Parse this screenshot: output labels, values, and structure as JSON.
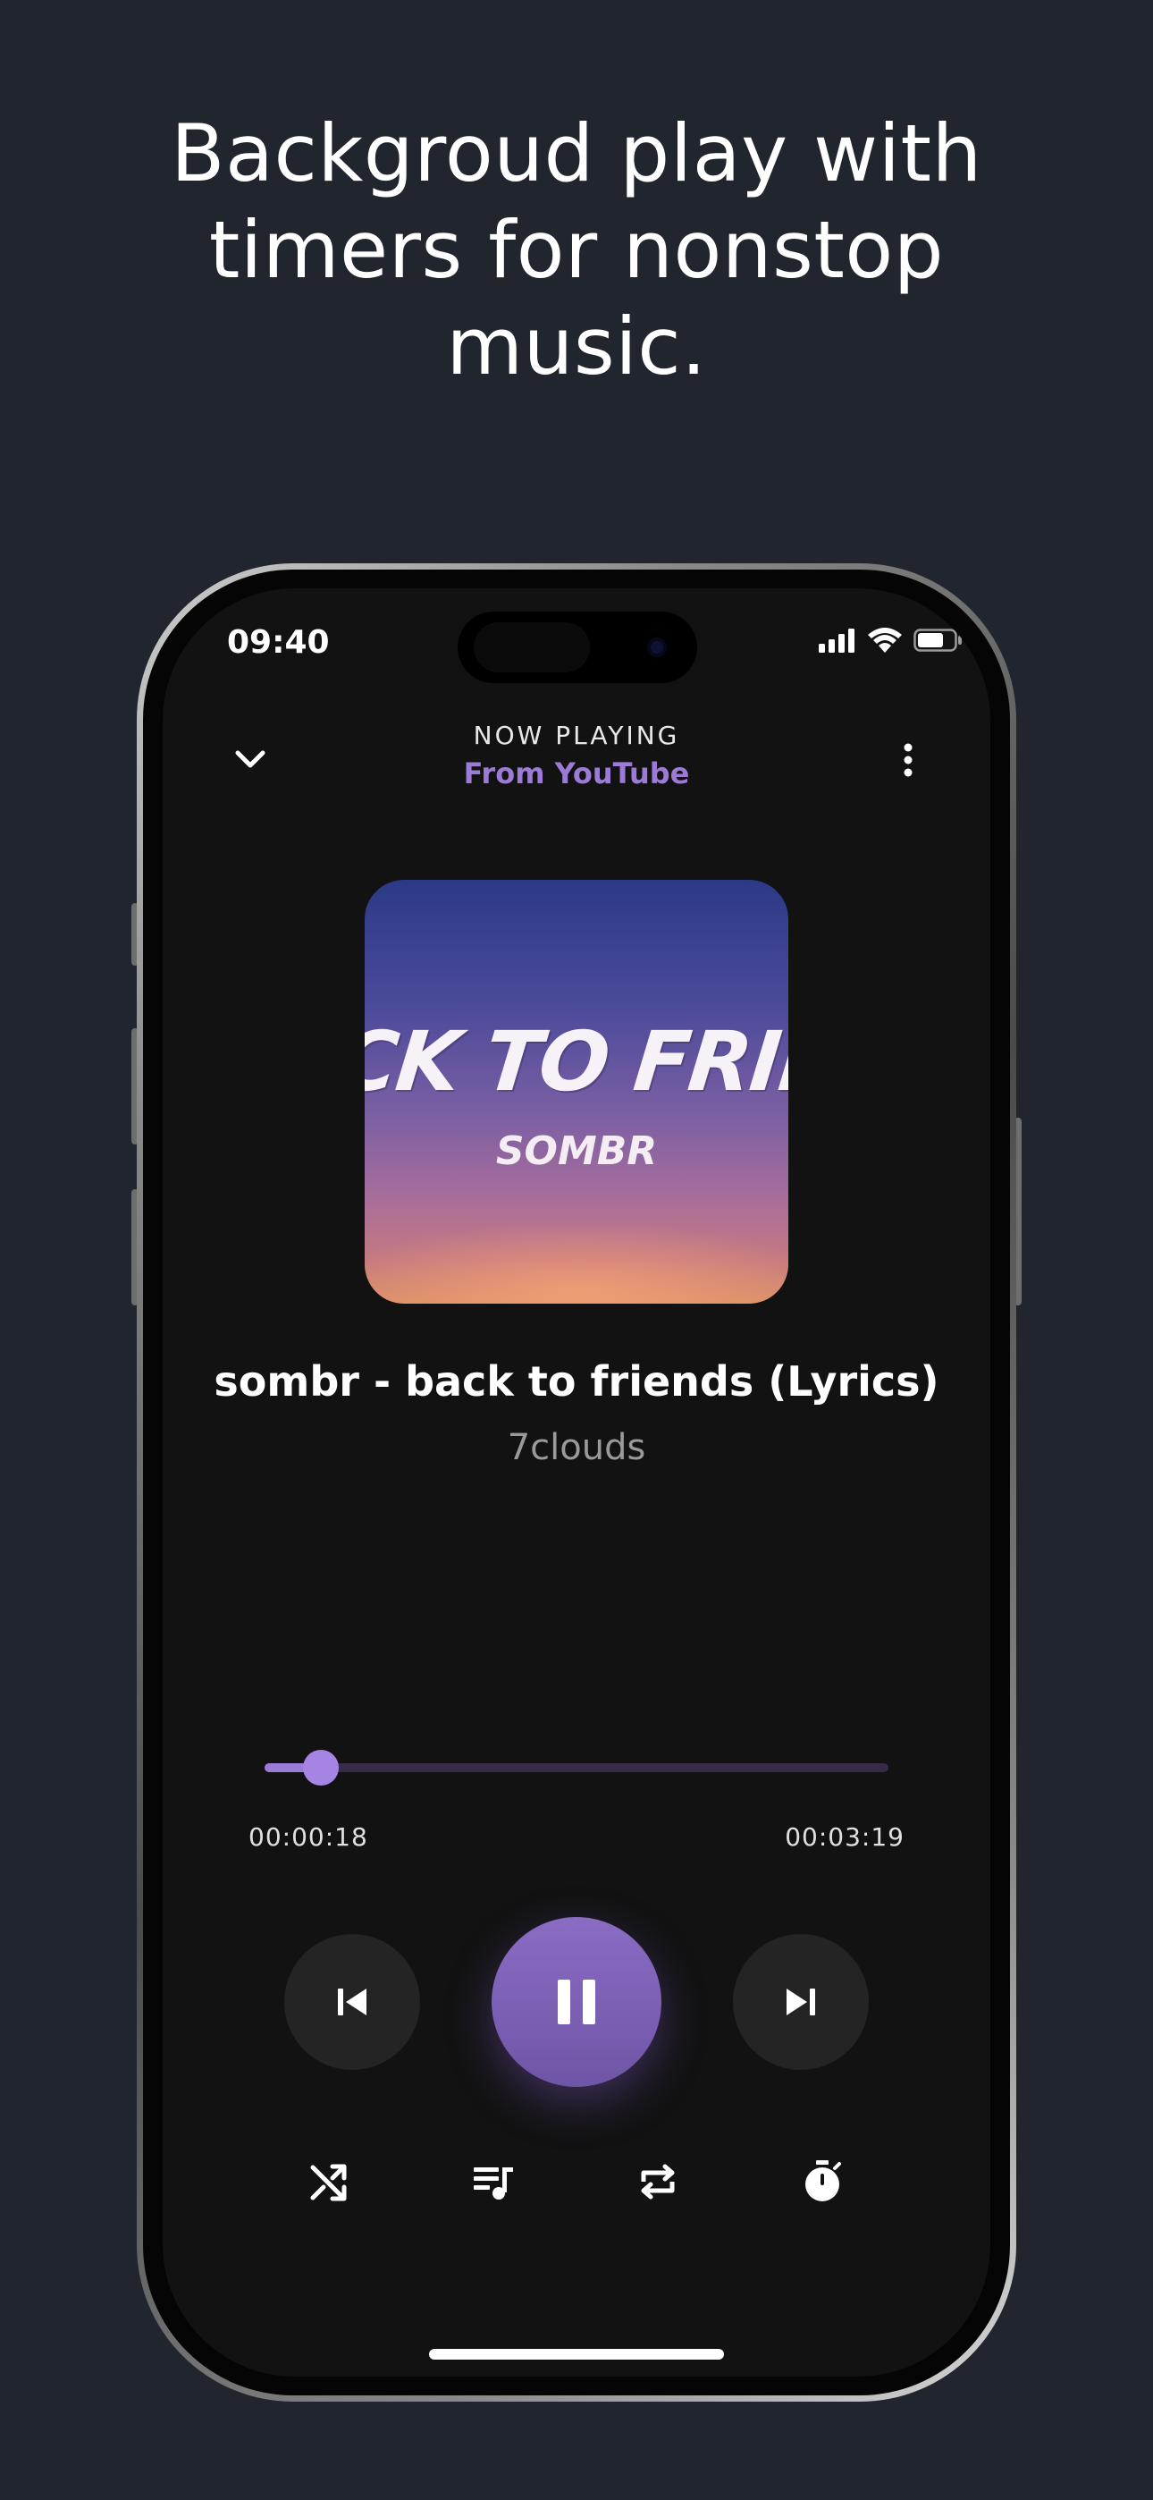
{
  "headline": {
    "line1": "Backgroud play with",
    "line2": "timers for nonstop",
    "line3": "music."
  },
  "status_bar": {
    "time": "09:40",
    "icons": [
      "cellular-signal-icon",
      "wifi-icon",
      "battery-icon"
    ]
  },
  "player_header": {
    "label": "NOW PLAYING",
    "source": "From YouTube",
    "icons": [
      "chevron-down-icon",
      "more-vertical-icon"
    ]
  },
  "album_art": {
    "title_text": "CK TO FRIEI",
    "artist_text": "SOMBR"
  },
  "track": {
    "title": "sombr - back to friends (Lyrics)",
    "artist": "7clouds"
  },
  "progress": {
    "current_time": "00:00:18",
    "total_time": "00:03:19",
    "fraction": 0.09
  },
  "controls": {
    "previous": "skip-previous-icon",
    "play_pause": "pause-icon",
    "next": "skip-next-icon"
  },
  "bottom_actions": [
    "shuffle-icon",
    "queue-music-icon",
    "repeat-icon",
    "sleep-timer-icon"
  ],
  "colors": {
    "accent": "#9b7bd6",
    "background": "#21252d",
    "screen": "#121212"
  }
}
